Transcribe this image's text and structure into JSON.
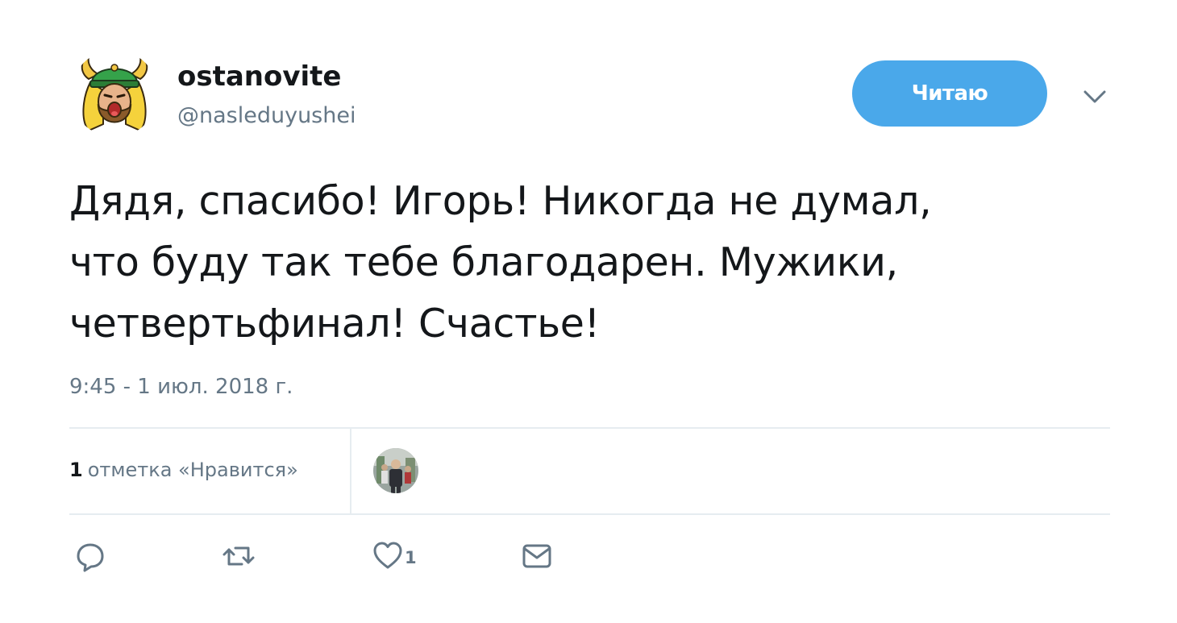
{
  "author": {
    "display_name": "ostanovite",
    "username": "@nasleduyushei",
    "avatar_icon": "viking-avatar-icon"
  },
  "follow_button": {
    "label": "Читаю",
    "color": "#4aa8ea"
  },
  "menu": {
    "icon": "chevron-down-icon"
  },
  "tweet": {
    "lines": [
      "Дядя, спасибо! Игорь! Никогда не думал,",
      "что буду так тебе благодарен. Мужики,",
      "четвертьфинал! Счастье!"
    ],
    "timestamp": "9:45 - 1 июл. 2018 г."
  },
  "stats": {
    "likes_count": "1",
    "likes_label": "отметка «Нравится»",
    "liker_avatar_icon": "user-avatar-icon"
  },
  "actions": {
    "reply_icon": "reply-icon",
    "retweet_icon": "retweet-icon",
    "like_icon": "heart-icon",
    "like_count": "1",
    "dm_icon": "envelope-icon"
  },
  "colors": {
    "text": "#14171a",
    "secondary": "#657786",
    "divider": "#e6ecf0",
    "accent": "#4aa8ea"
  }
}
